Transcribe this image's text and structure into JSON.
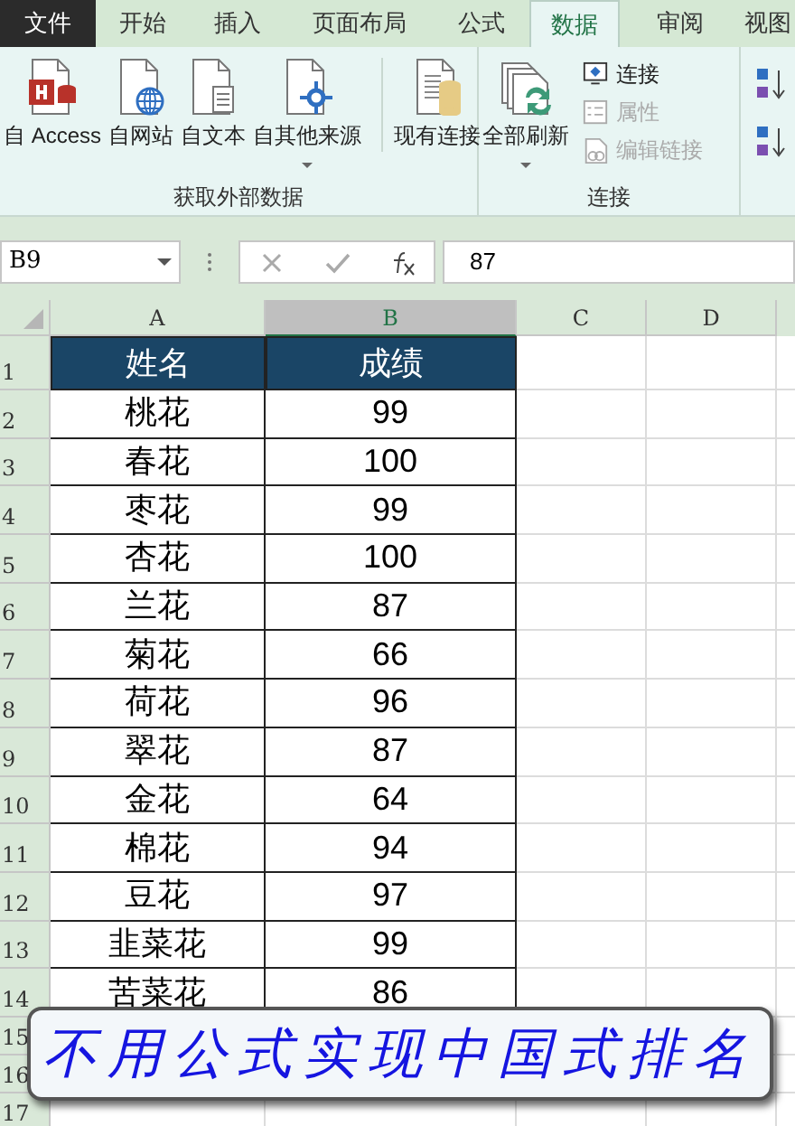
{
  "tabs": [
    {
      "label": "文件",
      "kind": "file",
      "selected": false
    },
    {
      "label": "开始",
      "kind": "tab",
      "selected": false
    },
    {
      "label": "插入",
      "kind": "tab",
      "selected": false
    },
    {
      "label": "页面布局",
      "kind": "tab",
      "selected": false
    },
    {
      "label": "公式",
      "kind": "tab",
      "selected": false
    },
    {
      "label": "数据",
      "kind": "tab",
      "selected": true
    },
    {
      "label": "审阅",
      "kind": "tab",
      "selected": false
    },
    {
      "label": "视图",
      "kind": "tab",
      "selected": false
    }
  ],
  "ribbon": {
    "groups": [
      {
        "label": "获取外部数据",
        "buttons": [
          {
            "label": "自 Access",
            "kind": "access",
            "has_menu": false
          },
          {
            "label": "自网站",
            "kind": "web",
            "has_menu": false
          },
          {
            "label": "自文本",
            "kind": "text",
            "has_menu": false
          },
          {
            "label": "自其他来源",
            "kind": "other",
            "has_menu": true
          },
          {
            "label": "现有连接",
            "kind": "existing",
            "has_menu": false
          }
        ]
      },
      {
        "label": "连接",
        "buttons": [
          {
            "label": "全部刷新",
            "kind": "refresh",
            "has_menu": true
          }
        ],
        "small_buttons": [
          {
            "label": "连接",
            "kind": "connections",
            "disabled": false
          },
          {
            "label": "属性",
            "kind": "properties",
            "disabled": true
          },
          {
            "label": "编辑链接",
            "kind": "links",
            "disabled": true
          }
        ]
      }
    ]
  },
  "formula_bar": {
    "name_box": "B9",
    "value": "87"
  },
  "sheet": {
    "columns": [
      {
        "label": "A",
        "selected": false
      },
      {
        "label": "B",
        "selected": true
      },
      {
        "label": "C",
        "selected": false
      },
      {
        "label": "D",
        "selected": false
      }
    ],
    "rows": [
      {
        "number": "1",
        "kind": "header",
        "cells": [
          "姓名",
          "成绩"
        ]
      },
      {
        "number": "2",
        "kind": "data",
        "cells": [
          "桃花",
          "99"
        ]
      },
      {
        "number": "3",
        "kind": "data",
        "cells": [
          "春花",
          "100"
        ]
      },
      {
        "number": "4",
        "kind": "data",
        "cells": [
          "枣花",
          "99"
        ]
      },
      {
        "number": "5",
        "kind": "data",
        "cells": [
          "杏花",
          "100"
        ]
      },
      {
        "number": "6",
        "kind": "data",
        "cells": [
          "兰花",
          "87"
        ]
      },
      {
        "number": "7",
        "kind": "data",
        "cells": [
          "菊花",
          "66"
        ]
      },
      {
        "number": "8",
        "kind": "data",
        "cells": [
          "荷花",
          "96"
        ]
      },
      {
        "number": "9",
        "kind": "data",
        "cells": [
          "翠花",
          "87"
        ]
      },
      {
        "number": "10",
        "kind": "data",
        "cells": [
          "金花",
          "64"
        ]
      },
      {
        "number": "11",
        "kind": "data",
        "cells": [
          "棉花",
          "94"
        ]
      },
      {
        "number": "12",
        "kind": "data",
        "cells": [
          "豆花",
          "97"
        ]
      },
      {
        "number": "13",
        "kind": "data",
        "cells": [
          "韭菜花",
          "99"
        ]
      },
      {
        "number": "14",
        "kind": "data",
        "cells": [
          "苦菜花",
          "86"
        ]
      },
      {
        "number": "15",
        "kind": "empty",
        "cells": []
      },
      {
        "number": "16",
        "kind": "empty",
        "cells": []
      },
      {
        "number": "17",
        "kind": "empty",
        "cells": []
      }
    ]
  },
  "banner": {
    "text": "不用公式实现中国式排名"
  }
}
